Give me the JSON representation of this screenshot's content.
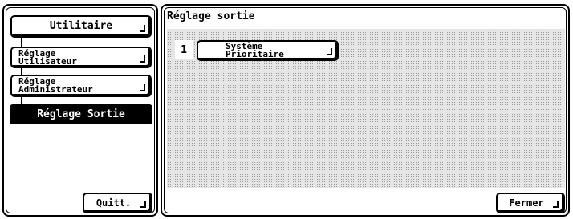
{
  "sidebar": {
    "items": [
      {
        "label": "Utilitaire"
      },
      {
        "line1": "Réglage",
        "line2": "Utilisateur"
      },
      {
        "line1": "Réglage",
        "line2": "Administrateur"
      },
      {
        "label": "Réglage Sortie"
      }
    ],
    "quit_label": "Quitt."
  },
  "main": {
    "title": "Réglage sortie",
    "rows": [
      {
        "number": "1",
        "line1": "Système",
        "line2": "Prioritaire"
      }
    ],
    "close_label": "Fermer"
  }
}
